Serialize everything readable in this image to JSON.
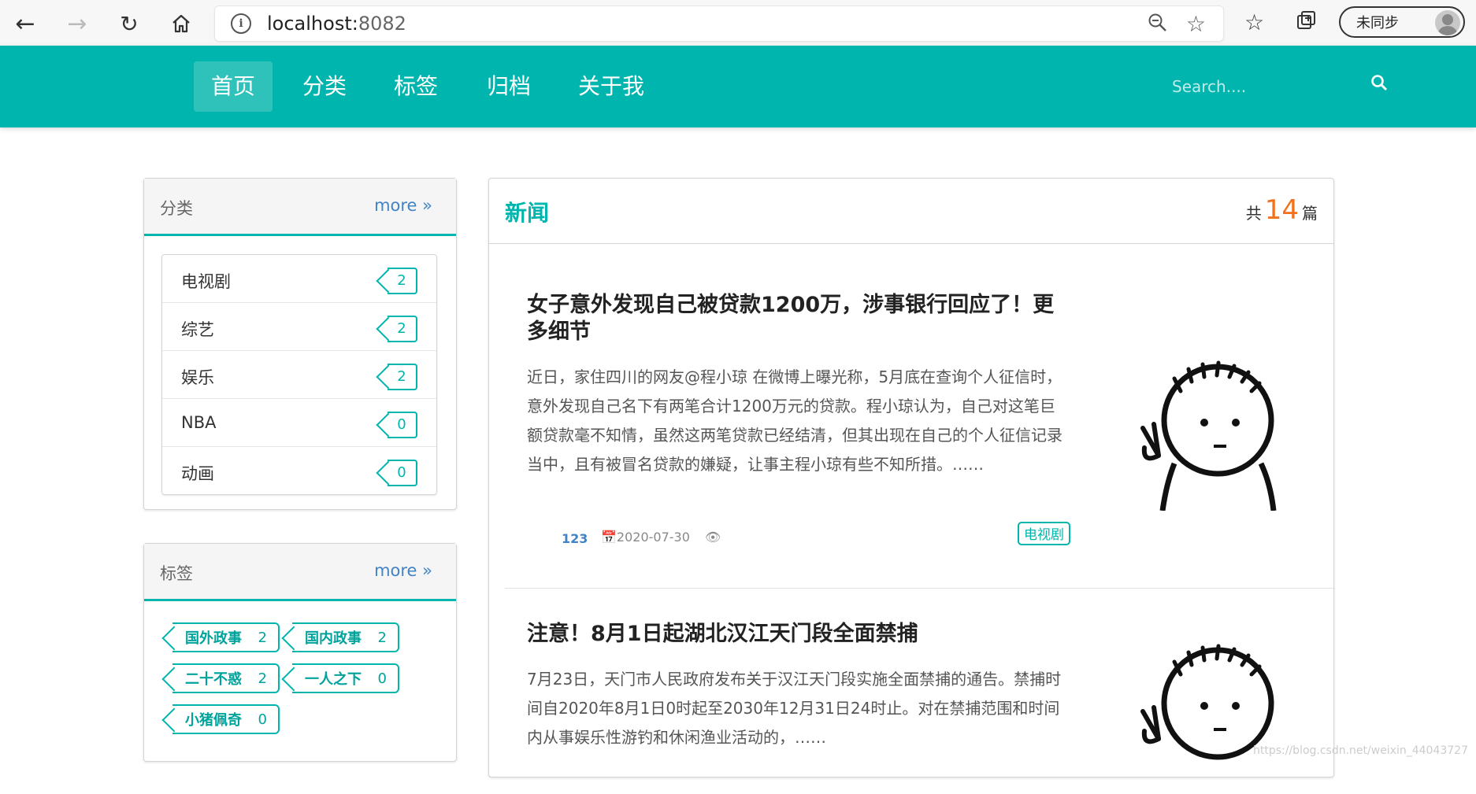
{
  "browser": {
    "url_host": "localhost:",
    "url_port": "8082",
    "sync_label": "未同步"
  },
  "nav": {
    "items": [
      {
        "label": "首页",
        "active": true
      },
      {
        "label": "分类",
        "active": false
      },
      {
        "label": "标签",
        "active": false
      },
      {
        "label": "归档",
        "active": false
      },
      {
        "label": "关于我",
        "active": false
      }
    ],
    "search_placeholder": "Search...."
  },
  "categories": {
    "title": "分类",
    "more": "more",
    "items": [
      {
        "name": "电视剧",
        "count": "2"
      },
      {
        "name": "综艺",
        "count": "2"
      },
      {
        "name": "娱乐",
        "count": "2"
      },
      {
        "name": "NBA",
        "count": "0"
      },
      {
        "name": "动画",
        "count": "0"
      }
    ]
  },
  "tags": {
    "title": "标签",
    "more": "more",
    "items": [
      {
        "name": "国外政事",
        "count": "2"
      },
      {
        "name": "国内政事",
        "count": "2"
      },
      {
        "name": "二十不惑",
        "count": "2"
      },
      {
        "name": "一人之下",
        "count": "0"
      },
      {
        "name": "小猪佩奇",
        "count": "0"
      }
    ]
  },
  "main": {
    "title": "新闻",
    "count_prefix": "共",
    "count": "14",
    "count_suffix": "篇",
    "articles": [
      {
        "title": "女子意外发现自己被贷款1200万，涉事银行回应了！更多细节",
        "excerpt": "近日，家住四川的网友@程小琼 在微博上曝光称，5月底在查询个人征信时，意外发现自己名下有两笔合计1200万元的贷款。程小琼认为，自己对这笔巨额贷款毫不知情，虽然这两笔贷款已经结清，但其出现在自己的个人征信记录当中，且有被冒名贷款的嫌疑，让事主程小琼有些不知所措。……",
        "author": "123",
        "date": "2020-07-30",
        "label": "电视剧"
      },
      {
        "title": "注意！8月1日起湖北汉江天门段全面禁捕",
        "excerpt": "7月23日，天门市人民政府发布关于汉江天门段实施全面禁捕的通告。禁捕时间自2020年8月1日0时起至2030年12月31日24时止。对在禁捕范围和时间内从事娱乐性游钓和休闲渔业活动的，……"
      }
    ]
  },
  "watermark": "https://blog.csdn.net/weixin_44043727"
}
